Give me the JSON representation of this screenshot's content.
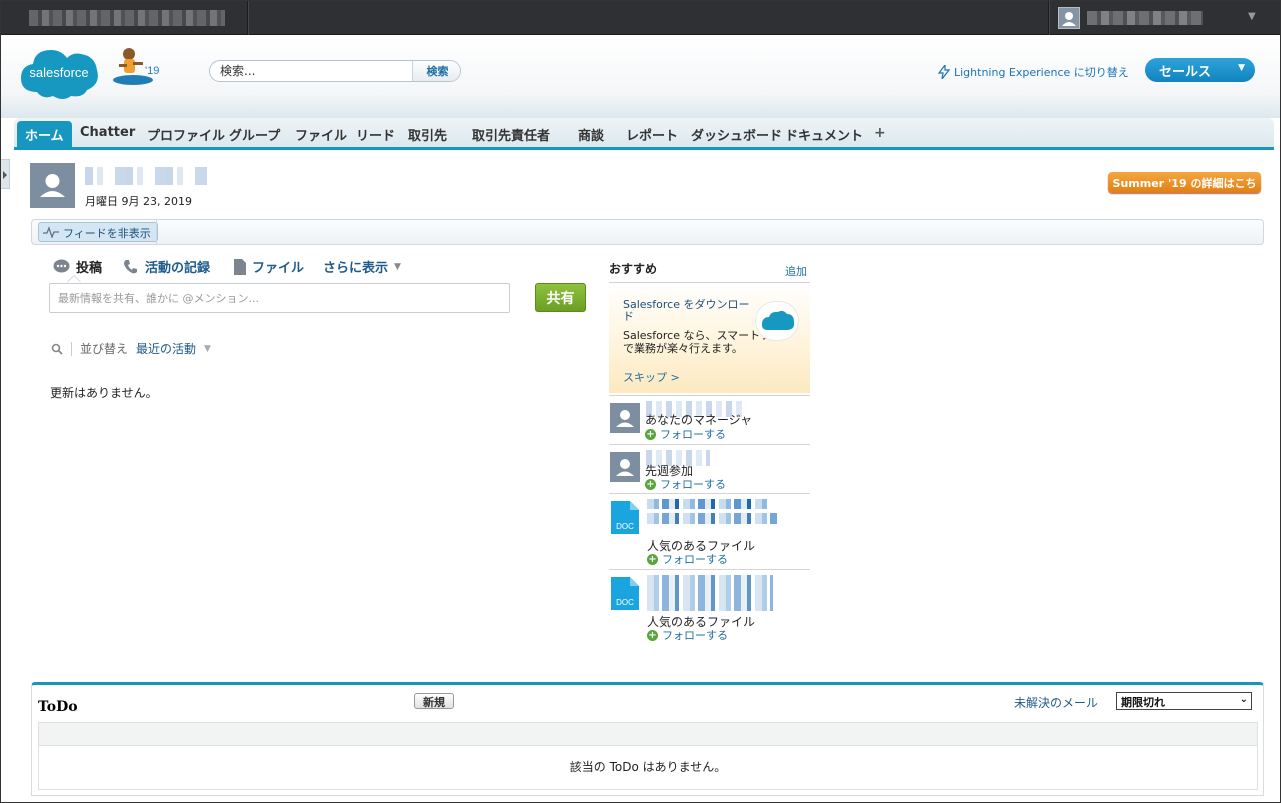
{
  "header": {
    "logo_text": "salesforce",
    "release_badge": "'19",
    "search_placeholder": "検索...",
    "search_button": "検索",
    "lightning_link": "Lightning Experience に切り替え",
    "app_menu": "セールス"
  },
  "tabs": [
    {
      "label": "ホーム",
      "active": true
    },
    {
      "label": "Chatter"
    },
    {
      "label": "プロファイル"
    },
    {
      "label": "グループ"
    },
    {
      "label": "ファイル"
    },
    {
      "label": "リード"
    },
    {
      "label": "取引先"
    },
    {
      "label": "取引先責任者"
    },
    {
      "label": "商談"
    },
    {
      "label": "レポート"
    },
    {
      "label": "ダッシュボード"
    },
    {
      "label": "ドキュメント"
    },
    {
      "label": "+"
    }
  ],
  "profile": {
    "date": "月曜日 9月 23, 2019",
    "summer_button": "Summer '19 の詳細はこちら"
  },
  "feed": {
    "toggle_label": "フィードを非表示"
  },
  "publisher": {
    "tabs": [
      "投稿",
      "活動の記録",
      "ファイル",
      "さらに表示"
    ],
    "input_placeholder": "最新情報を共有、誰かに @メンション...",
    "share_button": "共有",
    "sort_label": "並び替え",
    "sort_value": "最近の活動",
    "empty_text": "更新はありません。"
  },
  "recommendations": {
    "title": "おすすめ",
    "add_link": "追加",
    "promo_title": "Salesforce をダウンロード",
    "promo_desc": "Salesforce なら、スマートフォンで業務が楽々行えます。",
    "promo_skip": "スキップ >",
    "items": [
      {
        "sub": "あなたのマネージャ",
        "follow": "フォローする"
      },
      {
        "sub": "先週参加",
        "follow": "フォローする"
      },
      {
        "sub": "人気のあるファイル",
        "follow": "フォローする",
        "icon": "DOC"
      },
      {
        "sub": "人気のあるファイル",
        "follow": "フォローする",
        "icon": "DOC"
      }
    ]
  },
  "todo": {
    "title": "ToDo",
    "new_button": "新規",
    "mail_link": "未解決のメール",
    "filter_value": "期限切れ",
    "empty_text": "該当の ToDo はありません。"
  },
  "colors": {
    "brand": "#1797c0",
    "share_green": "#6b9e22",
    "summer_orange": "#e07f14"
  }
}
